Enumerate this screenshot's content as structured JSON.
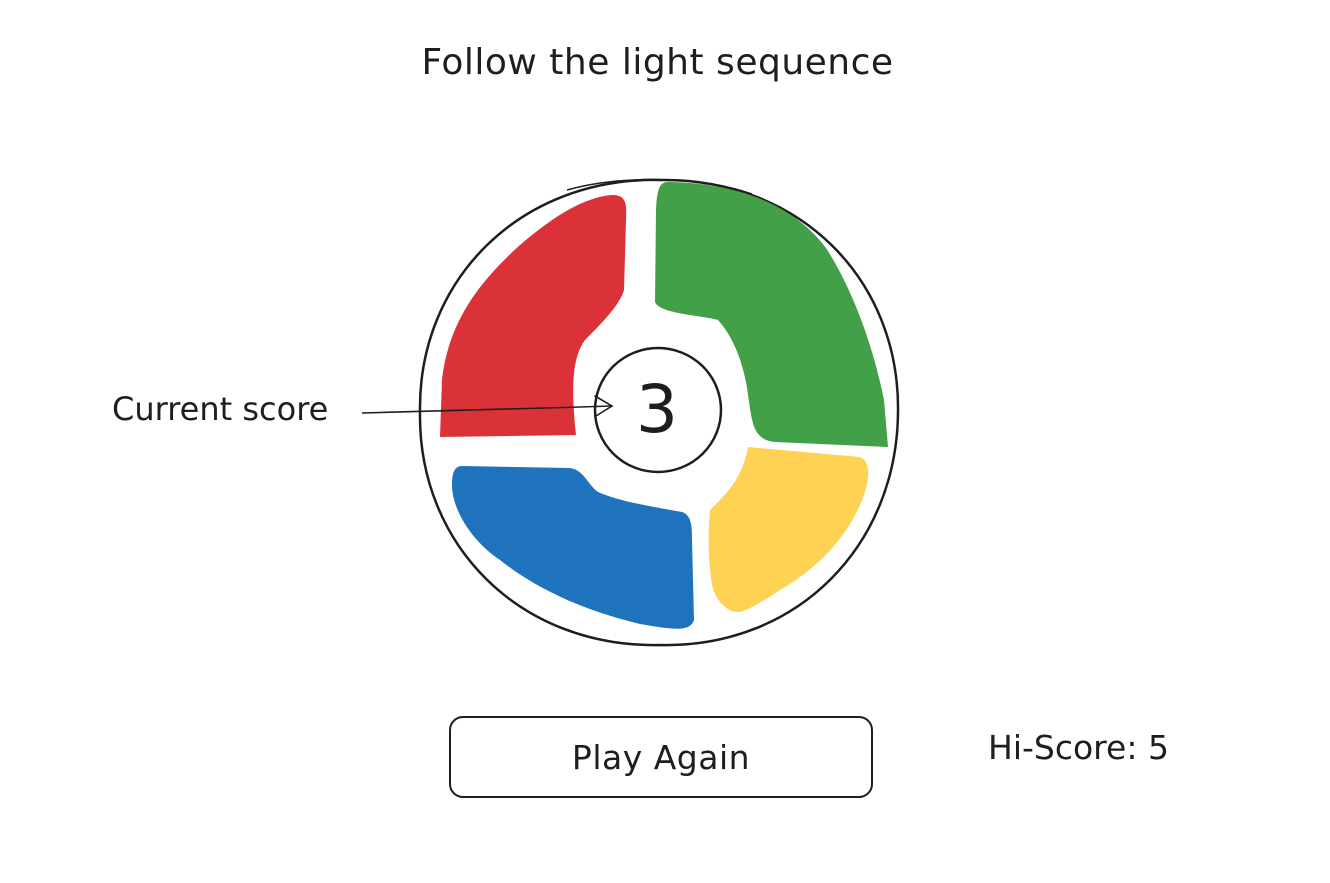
{
  "title": "Follow the light sequence",
  "score_annotation": "Current score",
  "current_score": "3",
  "play_again_label": "Play Again",
  "hiscore_label": "Hi-Score:",
  "hiscore_value": "5",
  "colors": {
    "red": "#db3139",
    "green": "#42a048",
    "blue": "#1f73bd",
    "yellow": "#fed353",
    "stroke": "#1e1e1e"
  }
}
